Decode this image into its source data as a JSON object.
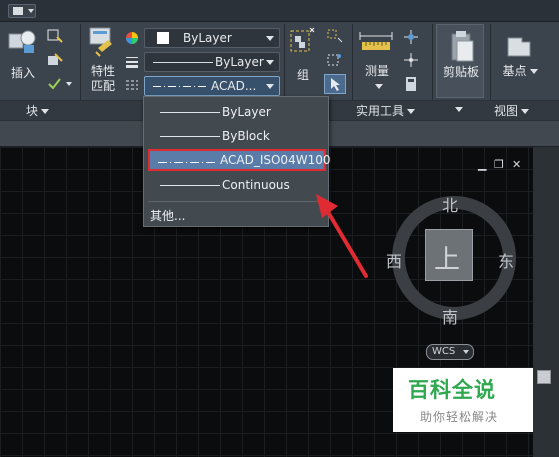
{
  "ribbon": {
    "groups": [
      {
        "name": "block",
        "label": "块"
      },
      {
        "name": "utilities",
        "label": "实用工具"
      },
      {
        "name": "view",
        "label": "视图"
      }
    ],
    "insert_label": "插入",
    "match_props_label": "特性\n匹配",
    "group_button_label": "组",
    "measure_label": "测量",
    "clipboard_label": "剪贴板",
    "basepoint_label": "基点",
    "color_prop_value": "ByLayer",
    "lineweight_prop_value": "ByLayer",
    "linetype_prop_value": "ACAD..."
  },
  "linetype_dropdown": {
    "items": [
      {
        "label": "ByLayer",
        "selected": false
      },
      {
        "label": "ByBlock",
        "selected": false
      },
      {
        "label": "ACAD_ISO04W100",
        "selected": true
      },
      {
        "label": "Continuous",
        "selected": false
      }
    ],
    "other_label": "其他..."
  },
  "viewcube": {
    "north": "北",
    "south": "南",
    "east": "东",
    "west": "西",
    "face": "上",
    "wcs_label": "WCS"
  },
  "window_controls": {
    "minimize": "▁",
    "restore": "❐",
    "close": "✕"
  },
  "watermark": {
    "title": "百科全说",
    "subtitle": "助你轻松解决"
  },
  "colors": {
    "accent_red": "#e12b33",
    "selection_blue": "#5a7ca9",
    "watermark_green": "#2fa84f"
  }
}
